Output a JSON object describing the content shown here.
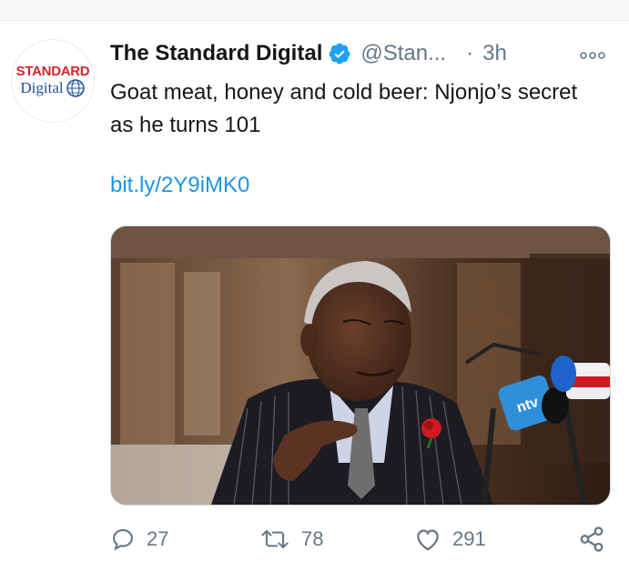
{
  "tweet": {
    "author_name": "The Standard Digital",
    "handle": "@Stan...",
    "separator": "·",
    "time": "3h",
    "text": "Goat meat, honey and cold beer: Njonjo’s secret as he turns 101",
    "link": "bit.ly/2Y9iMK0",
    "avatar_logo_top": "STANDARD",
    "avatar_logo_bottom": "Digital",
    "photo_mic_label": "ntv"
  },
  "actions": {
    "replies": "27",
    "retweets": "78",
    "likes": "291"
  },
  "colors": {
    "text": "#14171a",
    "muted": "#657786",
    "link": "#1b95e0",
    "verified": "#1da1f2",
    "brand_red": "#d4232c",
    "brand_blue": "#1f4e9c"
  },
  "icons": [
    "verified-badge-icon",
    "more-options-icon",
    "reply-icon",
    "retweet-icon",
    "like-icon",
    "share-icon"
  ]
}
